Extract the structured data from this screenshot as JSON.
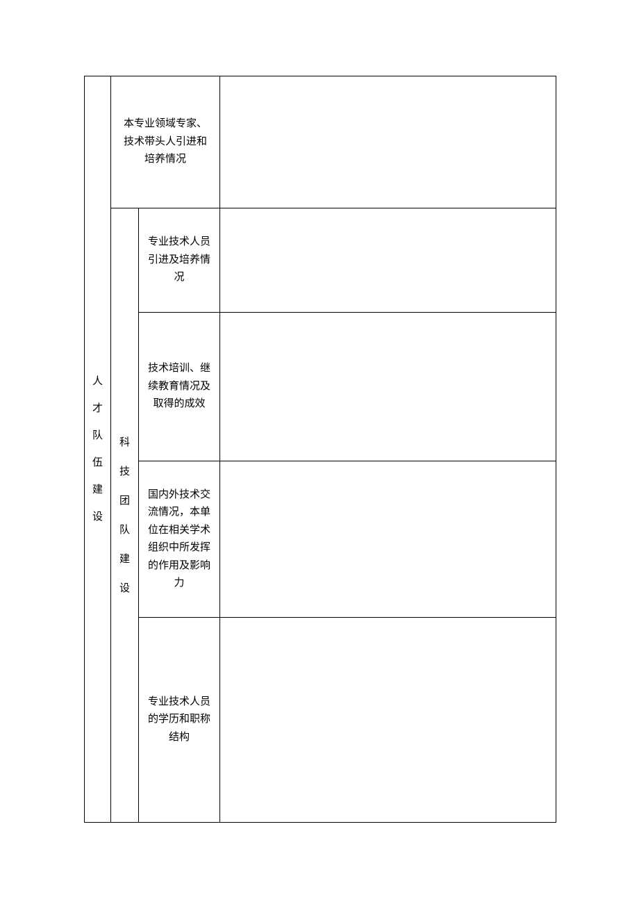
{
  "table": {
    "category": "人才队伍建设",
    "row_top": {
      "label": "本专业领域专家、技术带头人引进和培养情况",
      "value": ""
    },
    "subcategory": "科技团队建设",
    "items": [
      {
        "label": "专业技术人员引进及培养情况",
        "value": ""
      },
      {
        "label": "技术培训、继续教育情况及取得的成效",
        "value": ""
      },
      {
        "label": "国内外技术交流情况，本单位在相关学术组织中所发挥的作用及影响力",
        "value": ""
      },
      {
        "label": "专业技术人员的学历和职称结构",
        "value": ""
      }
    ]
  }
}
